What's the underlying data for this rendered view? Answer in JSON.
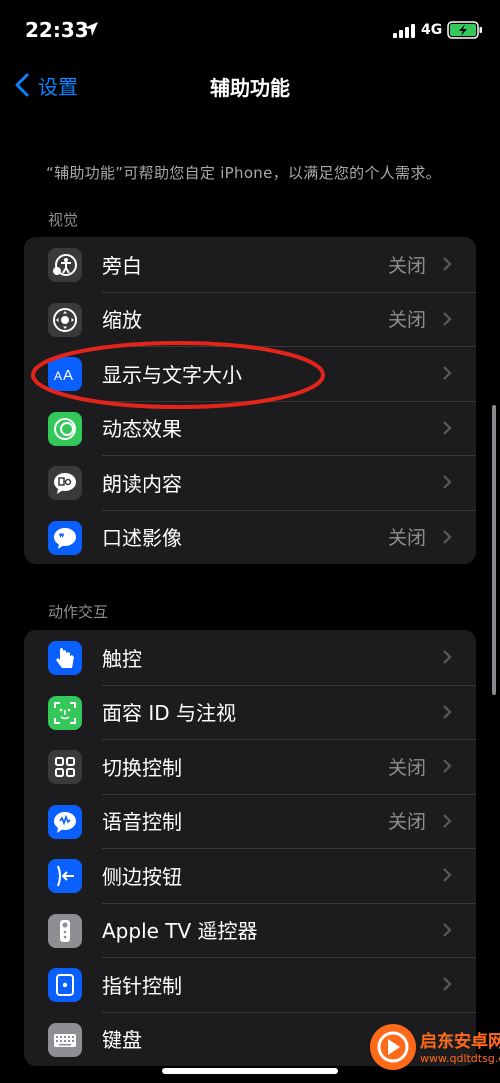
{
  "status": {
    "time": "22:33",
    "network": "4G"
  },
  "nav": {
    "back_label": "设置",
    "title": "辅助功能"
  },
  "description": "“辅助功能”可帮助您自定 iPhone，以满足您的个人需求。",
  "sections": [
    {
      "title": "视觉",
      "items": [
        {
          "label": "旁白",
          "value": "关闭",
          "icon": "voiceover-icon",
          "color": "#3a3a3c"
        },
        {
          "label": "缩放",
          "value": "关闭",
          "icon": "zoom-icon",
          "color": "#3a3a3c"
        },
        {
          "label": "显示与文字大小",
          "value": "",
          "icon": "text-size-icon",
          "color": "#0a60ff"
        },
        {
          "label": "动态效果",
          "value": "",
          "icon": "motion-icon",
          "color": "#34c759"
        },
        {
          "label": "朗读内容",
          "value": "",
          "icon": "speech-bubble-icon",
          "color": "#3a3a3c"
        },
        {
          "label": "口述影像",
          "value": "关闭",
          "icon": "audio-description-icon",
          "color": "#0a60ff"
        }
      ]
    },
    {
      "title": "动作交互",
      "items": [
        {
          "label": "触控",
          "value": "",
          "icon": "hand-touch-icon",
          "color": "#0a60ff"
        },
        {
          "label": "面容 ID 与注视",
          "value": "",
          "icon": "face-id-icon",
          "color": "#34c759"
        },
        {
          "label": "切换控制",
          "value": "关闭",
          "icon": "grid-icon",
          "color": "#3a3a3c"
        },
        {
          "label": "语音控制",
          "value": "关闭",
          "icon": "voice-control-icon",
          "color": "#0a60ff"
        },
        {
          "label": "侧边按钮",
          "value": "",
          "icon": "side-button-icon",
          "color": "#0a60ff"
        },
        {
          "label": "Apple TV 遥控器",
          "value": "",
          "icon": "remote-icon",
          "color": "#8e8e93"
        },
        {
          "label": "指针控制",
          "value": "",
          "icon": "pointer-icon",
          "color": "#0a60ff"
        },
        {
          "label": "键盘",
          "value": "",
          "icon": "keyboard-icon",
          "color": "#8e8e93"
        }
      ]
    }
  ],
  "watermark": {
    "name": "启东安卓网",
    "url": "www.qdltdtsg.com"
  },
  "colors": {
    "accent": "#0a84ff",
    "highlight_circle": "#e3241b"
  }
}
